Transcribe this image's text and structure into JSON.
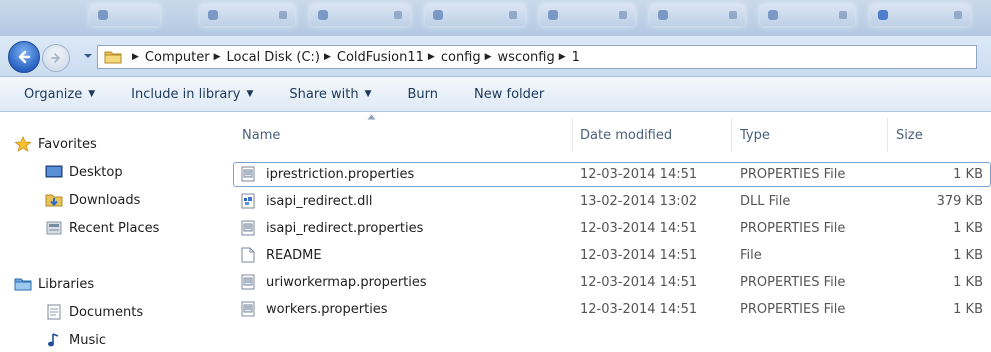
{
  "breadcrumb": [
    "Computer",
    "Local Disk (C:)",
    "ColdFusion11",
    "config",
    "wsconfig",
    "1"
  ],
  "commands": [
    {
      "label": "Organize",
      "dropdown": true
    },
    {
      "label": "Include in library",
      "dropdown": true
    },
    {
      "label": "Share with",
      "dropdown": true
    },
    {
      "label": "Burn",
      "dropdown": false
    },
    {
      "label": "New folder",
      "dropdown": false
    }
  ],
  "nav": {
    "favorites": {
      "label": "Favorites",
      "icon": "star-icon"
    },
    "favorite_items": [
      {
        "label": "Desktop",
        "icon": "desktop-icon"
      },
      {
        "label": "Downloads",
        "icon": "downloads-folder-icon"
      },
      {
        "label": "Recent Places",
        "icon": "recent-places-icon"
      }
    ],
    "libraries": {
      "label": "Libraries",
      "icon": "libraries-icon"
    },
    "library_items": [
      {
        "label": "Documents",
        "icon": "documents-icon"
      },
      {
        "label": "Music",
        "icon": "music-icon"
      }
    ]
  },
  "columns": {
    "name": "Name",
    "date": "Date modified",
    "type": "Type",
    "size": "Size"
  },
  "files": [
    {
      "name": "iprestriction.properties",
      "date": "12-03-2014 14:51",
      "type": "PROPERTIES File",
      "size": "1 KB",
      "icon": "properties-file-icon",
      "selected": true
    },
    {
      "name": "isapi_redirect.dll",
      "date": "13-02-2014 13:02",
      "type": "DLL File",
      "size": "379 KB",
      "icon": "dll-file-icon",
      "selected": false
    },
    {
      "name": "isapi_redirect.properties",
      "date": "12-03-2014 14:51",
      "type": "PROPERTIES File",
      "size": "1 KB",
      "icon": "properties-file-icon",
      "selected": false
    },
    {
      "name": "README",
      "date": "12-03-2014 14:51",
      "type": "File",
      "size": "1 KB",
      "icon": "blank-file-icon",
      "selected": false
    },
    {
      "name": "uriworkermap.properties",
      "date": "12-03-2014 14:51",
      "type": "PROPERTIES File",
      "size": "1 KB",
      "icon": "properties-file-icon",
      "selected": false
    },
    {
      "name": "workers.properties",
      "date": "12-03-2014 14:51",
      "type": "PROPERTIES File",
      "size": "1 KB",
      "icon": "properties-file-icon",
      "selected": false
    }
  ]
}
